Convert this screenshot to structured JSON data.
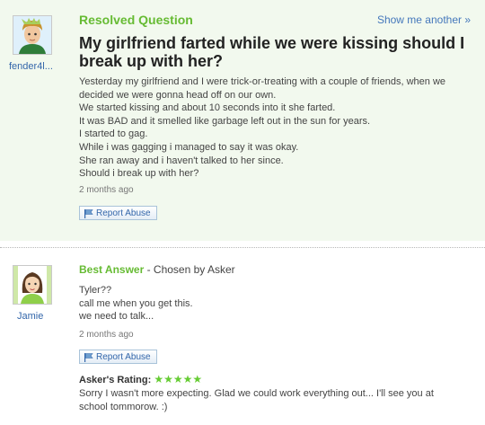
{
  "question": {
    "status": "Resolved Question",
    "show_another": "Show me another »",
    "asker_name": "fender4l...",
    "title": "My girlfriend farted while we were kissing should I break up with her?",
    "body_lines": [
      "Yesterday my girlfriend and I were trick-or-treating with a couple of friends, when we",
      "decided we were gonna head off on our own.",
      "We started kissing and about 10 seconds into it she farted.",
      "It was BAD and it smelled like garbage left out in the sun for years.",
      "I started to gag.",
      "While i was gagging i managed to say it was okay.",
      "She ran away and i haven't talked to her since.",
      "Should i break up with her?"
    ],
    "time_ago": "2 months ago",
    "report_label": "Report Abuse"
  },
  "best_answer": {
    "label": "Best Answer",
    "chosen_by": " - Chosen by Asker",
    "answerer_name": "Jamie",
    "body_lines": [
      "Tyler??",
      "call me when you get this.",
      "we need to talk..."
    ],
    "time_ago": "2 months ago",
    "report_label": "Report Abuse",
    "rating_label": "Asker's Rating:",
    "rating_stars": "★★★★★",
    "rating_value": 5,
    "rating_max": 5,
    "rating_comment": "Sorry I wasn't more expecting. Glad we could work everything out... I'll see you at school tommorow. :)"
  },
  "colors": {
    "accent_green": "#66bb33",
    "link_blue": "#4477bb",
    "question_bg": "#f2f9ee"
  },
  "icons": {
    "report": "flag-icon",
    "asker_avatar": "avatar-boy-icon",
    "answerer_avatar": "avatar-girl-icon"
  }
}
